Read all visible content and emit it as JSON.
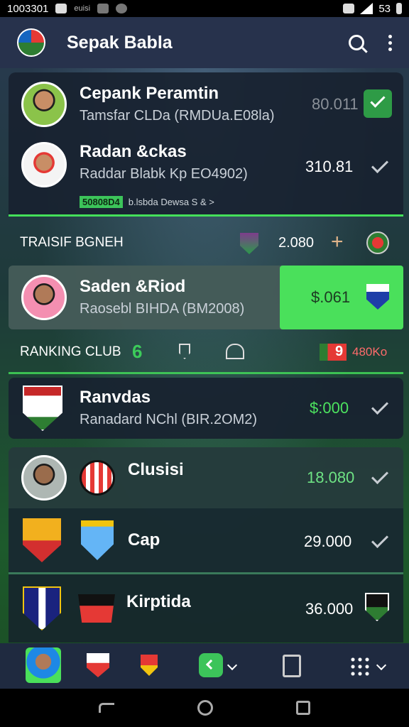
{
  "status_bar": {
    "time": "1003301",
    "app_label": "euisi",
    "battery": "53"
  },
  "app_bar": {
    "title": "Sepak Babla"
  },
  "transfers": [
    {
      "name": "Cepank Peramtin",
      "sub": "Tamsfar CLDa (RMDUa.E08la)",
      "value": "80.011",
      "checked": true
    },
    {
      "name": "Radan &ckas",
      "sub": "Raddar Blabk Kp EO4902)",
      "value": "310.81",
      "checked": true
    }
  ],
  "link_strip": {
    "tag": "50808D4",
    "text": "b.lsbda Dewsa S & >"
  },
  "transfer_header": {
    "label": "TRAISIF BGNEH",
    "value": "2.080",
    "plus": "+"
  },
  "highlight": {
    "name": "Saden &Riod",
    "sub": "Raosebl BIHDA (BM2008)",
    "value": "$.061"
  },
  "ranking_header": {
    "label": "RANKING CLUB",
    "num": "6",
    "flag_num": "9",
    "value": "480Ko"
  },
  "rank_rows": [
    {
      "name": "Ranvdas",
      "sub": "Ranadard NChl (BIR.2OM2)",
      "value": "$:000",
      "value_color": "#4ce35f",
      "check": true
    },
    {
      "name": "Clusisi",
      "value": "18.080",
      "value_color": "#6ee384",
      "check": true
    },
    {
      "name": "Cap",
      "value": "29.000",
      "value_color": "#ffffff",
      "check": true
    },
    {
      "name": "Kirptida",
      "value": "36.000",
      "value_color": "#ffffff",
      "check": false
    }
  ],
  "colors": {
    "accent_green": "#44e05a",
    "card": "#182230",
    "appbar": "#27324c"
  }
}
